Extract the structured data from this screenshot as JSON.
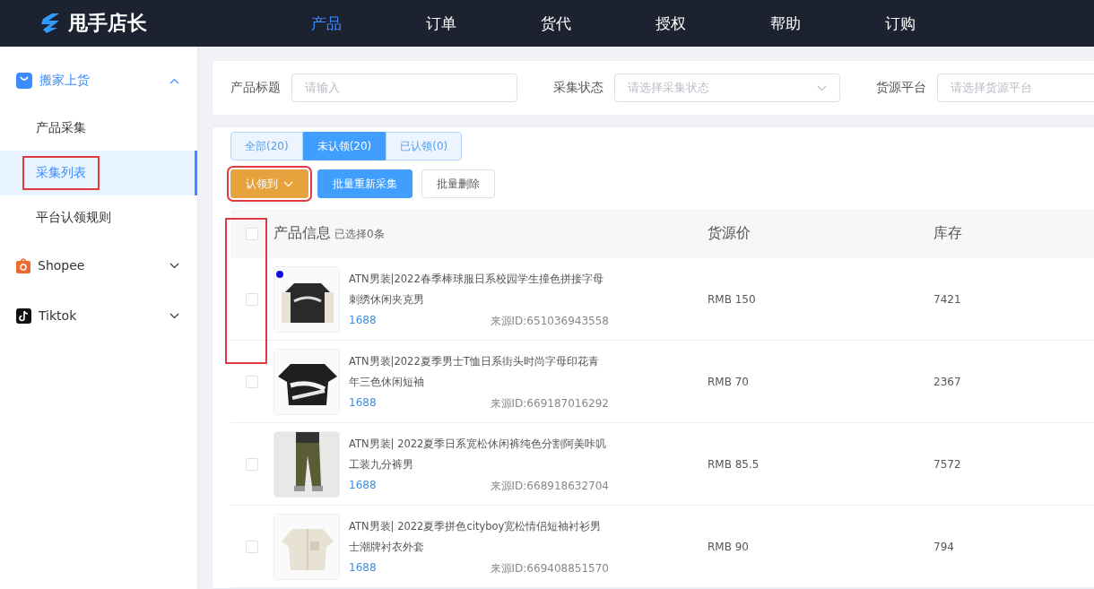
{
  "header": {
    "logo": "甩手店长",
    "nav": [
      {
        "label": "产品",
        "selected": true
      },
      {
        "label": "订单",
        "selected": false
      },
      {
        "label": "货代",
        "selected": false
      },
      {
        "label": "授权",
        "selected": false
      },
      {
        "label": "帮助",
        "selected": false
      },
      {
        "label": "订购",
        "selected": false
      }
    ]
  },
  "sidebar": {
    "groups": [
      {
        "kind": "bag",
        "label": "搬家上货",
        "expanded": true,
        "children": [
          {
            "label": "产品采集",
            "selected": false
          },
          {
            "label": "采集列表",
            "selected": true,
            "highlighted": true
          },
          {
            "label": "平台认领规则",
            "selected": false
          }
        ]
      },
      {
        "kind": "shopee",
        "label": "Shopee",
        "expanded": false
      },
      {
        "kind": "tiktok",
        "label": "Tiktok",
        "expanded": false
      }
    ]
  },
  "filters": [
    {
      "kind": "input",
      "label": "产品标题",
      "placeholder": "请输入"
    },
    {
      "kind": "select",
      "label": "采集状态",
      "placeholder": "请选择采集状态"
    },
    {
      "kind": "input",
      "label": "货源平台",
      "placeholder": "请选择货源平台"
    }
  ],
  "tabs": [
    {
      "label": "全部(20)",
      "selected": false
    },
    {
      "label": "未认领(20)",
      "selected": true
    },
    {
      "label": "已认领(0)",
      "selected": false
    }
  ],
  "actions": [
    {
      "kind": "dropdown",
      "label": "认领到",
      "highlighted": true
    },
    {
      "kind": "primary",
      "label": "批量重新采集",
      "highlighted": false
    },
    {
      "kind": "plain",
      "label": "批量删除",
      "highlighted": false
    }
  ],
  "table": {
    "columns": [
      "产品信息",
      "货源价",
      "库存"
    ],
    "selection_note": "已选择0条",
    "all_checked": false,
    "checkbox_highlighted": true,
    "rows": [
      {
        "checked": false,
        "marked": true,
        "title": "ATN男装|2022春季棒球服日系校园学生撞色拼接字母刺绣休闲夹克男",
        "platform": "1688",
        "source_id": "来源ID:651036943558",
        "price": "RMB 150",
        "stock": "7421"
      },
      {
        "checked": false,
        "marked": false,
        "title": "ATN男装|2022夏季男士T恤日系街头时尚字母印花青年三色休闲短袖",
        "platform": "1688",
        "source_id": "来源ID:669187016292",
        "price": "RMB 70",
        "stock": "2367"
      },
      {
        "checked": false,
        "marked": false,
        "title": "ATN男装| 2022夏季日系宽松休闲裤纯色分割阿美咔叽工装九分裤男",
        "platform": "1688",
        "source_id": "来源ID:668918632704",
        "price": "RMB 85.5",
        "stock": "7572"
      },
      {
        "checked": false,
        "marked": false,
        "title": "ATN男装| 2022夏季拼色cityboy宽松情侣短袖衬衫男士潮牌衬衣外套",
        "platform": "1688",
        "source_id": "来源ID:669408851570",
        "price": "RMB 90",
        "stock": "794"
      }
    ]
  }
}
